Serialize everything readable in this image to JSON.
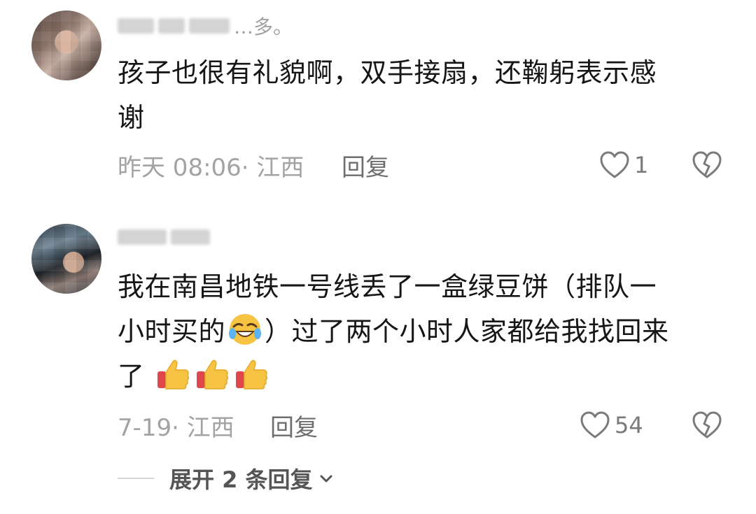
{
  "comments": [
    {
      "username_visible": "…多。",
      "text_line1": "孩子也很有礼貌啊，双手接扇，还鞠躬表示感",
      "text_line2": "谢",
      "time_location": "昨天 08:06· 江西",
      "reply_label": "回复",
      "like_count": "1"
    },
    {
      "text_line1": "我在南昌地铁一号线丢了一盒绿豆饼（排队一",
      "text_line2a": "小时买的",
      "text_line2b": "）过了两个小时人家都给我找回来",
      "text_line3": "了",
      "emoji_names": [
        "rolling-laughing-emoji",
        "thumbs-up-emoji"
      ],
      "time_location": "7-19· 江西",
      "reply_label": "回复",
      "like_count": "54"
    }
  ],
  "expand_replies": {
    "label": "展开 2 条回复"
  },
  "colors": {
    "text": "#161616",
    "meta": "#a3a3a3",
    "reply": "#6e6e6e",
    "icon": "#7a7a7a",
    "thumb_yellow": "#f6c343",
    "thumb_cuff": "#e0474c"
  }
}
